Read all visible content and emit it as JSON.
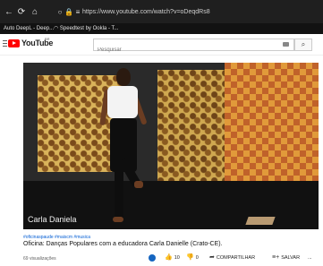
{
  "browser": {
    "url": "https://www.youtube.com/watch?v=oDeqdRs8",
    "bookmarks": [
      {
        "label": "Auto DeepL - Deep..."
      },
      {
        "label": "Speedtest by Ookla - T..."
      }
    ]
  },
  "youtube": {
    "logo_text": "YouTube",
    "logo_region": "BR",
    "search_placeholder": "Pesquisar"
  },
  "video": {
    "overlay_caption": "Carla Daniela",
    "hashtags": "#oficinaspaude #maiscm #musica",
    "title": "Oficina: Danças Populares com a educadora Carla Danielle (Crato-CE).",
    "views": "69 visualizações",
    "likes": "10",
    "dislikes": "0",
    "share_label": "COMPARTILHAR",
    "save_label": "SALVAR",
    "more_label": "..."
  }
}
